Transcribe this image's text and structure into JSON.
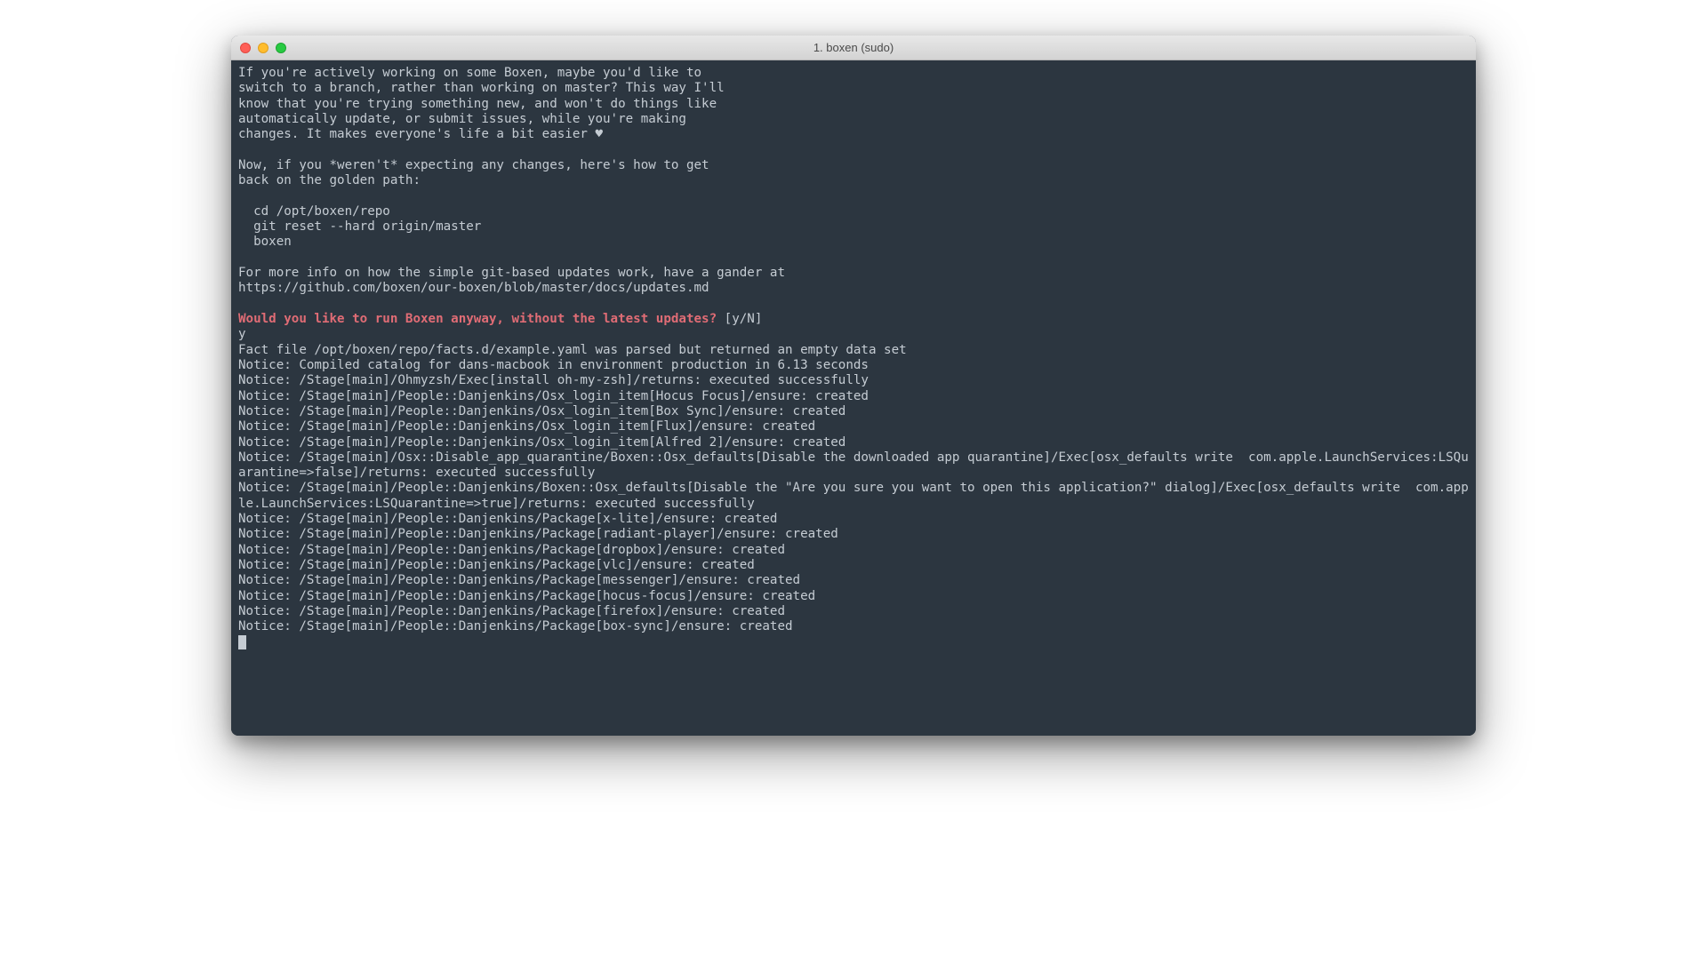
{
  "window": {
    "title": "1. boxen (sudo)"
  },
  "terminal": {
    "intro_lines": [
      "If you're actively working on some Boxen, maybe you'd like to",
      "switch to a branch, rather than working on master? This way I'll",
      "know that you're trying something new, and won't do things like",
      "automatically update, or submit issues, while you're making",
      "changes. It makes everyone's life a bit easier ♥",
      "",
      "Now, if you *weren't* expecting any changes, here's how to get",
      "back on the golden path:",
      "",
      "  cd /opt/boxen/repo",
      "  git reset --hard origin/master",
      "  boxen",
      "",
      "For more info on how the simple git-based updates work, have a gander at",
      "https://github.com/boxen/our-boxen/blob/master/docs/updates.md",
      ""
    ],
    "prompt_question": "Would you like to run Boxen anyway, without the latest updates?",
    "prompt_choices": " [y/N]",
    "user_input": "y",
    "output_lines": [
      "Fact file /opt/boxen/repo/facts.d/example.yaml was parsed but returned an empty data set",
      "Notice: Compiled catalog for dans-macbook in environment production in 6.13 seconds",
      "Notice: /Stage[main]/Ohmyzsh/Exec[install oh-my-zsh]/returns: executed successfully",
      "Notice: /Stage[main]/People::Danjenkins/Osx_login_item[Hocus Focus]/ensure: created",
      "Notice: /Stage[main]/People::Danjenkins/Osx_login_item[Box Sync]/ensure: created",
      "Notice: /Stage[main]/People::Danjenkins/Osx_login_item[Flux]/ensure: created",
      "Notice: /Stage[main]/People::Danjenkins/Osx_login_item[Alfred 2]/ensure: created",
      "Notice: /Stage[main]/Osx::Disable_app_quarantine/Boxen::Osx_defaults[Disable the downloaded app quarantine]/Exec[osx_defaults write  com.apple.LaunchServices:LSQuarantine=>false]/returns: executed successfully",
      "Notice: /Stage[main]/People::Danjenkins/Boxen::Osx_defaults[Disable the \"Are you sure you want to open this application?\" dialog]/Exec[osx_defaults write  com.apple.LaunchServices:LSQuarantine=>true]/returns: executed successfully",
      "Notice: /Stage[main]/People::Danjenkins/Package[x-lite]/ensure: created",
      "Notice: /Stage[main]/People::Danjenkins/Package[radiant-player]/ensure: created",
      "Notice: /Stage[main]/People::Danjenkins/Package[dropbox]/ensure: created",
      "Notice: /Stage[main]/People::Danjenkins/Package[vlc]/ensure: created",
      "Notice: /Stage[main]/People::Danjenkins/Package[messenger]/ensure: created",
      "Notice: /Stage[main]/People::Danjenkins/Package[hocus-focus]/ensure: created",
      "Notice: /Stage[main]/People::Danjenkins/Package[firefox]/ensure: created",
      "Notice: /Stage[main]/People::Danjenkins/Package[box-sync]/ensure: created"
    ]
  }
}
